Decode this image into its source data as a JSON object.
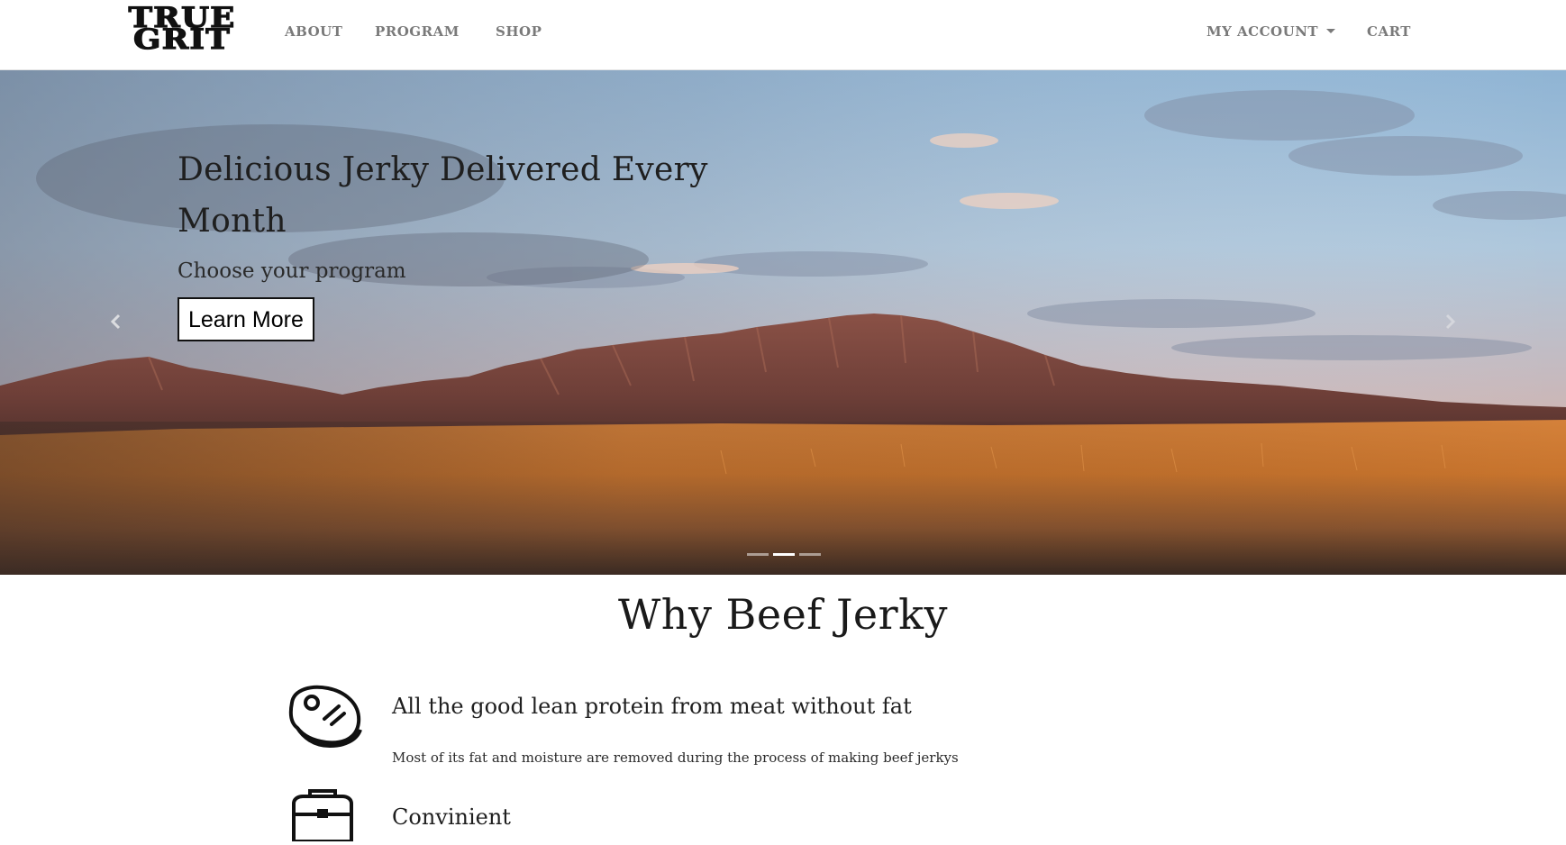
{
  "brand": {
    "logo_line1": "TRUE",
    "logo_line2": "GRIT"
  },
  "nav": {
    "left": [
      "ABOUT",
      "PROGRAM",
      "SHOP"
    ],
    "account_label": "MY ACCOUNT",
    "cart_label": "CART"
  },
  "hero": {
    "title": "Delicious Jerky Delivered Every Month",
    "subtitle": "Choose your program",
    "button_label": "Learn More",
    "slide_count": 3,
    "active_slide": 2
  },
  "why": {
    "title": "Why Beef Jerky",
    "features": [
      {
        "icon": "steak-icon",
        "title": "All the good lean protein from meat without fat",
        "description": "Most of its fat and moisture are removed during the process of making beef jerkys"
      },
      {
        "icon": "bag-icon",
        "title": "Convinient",
        "description": ""
      }
    ]
  },
  "colors": {
    "nav_text": "#7a7a7a",
    "text_dark": "#1f1f1f",
    "sky_top": "#9fc2dc",
    "grass": "#c9752c"
  }
}
